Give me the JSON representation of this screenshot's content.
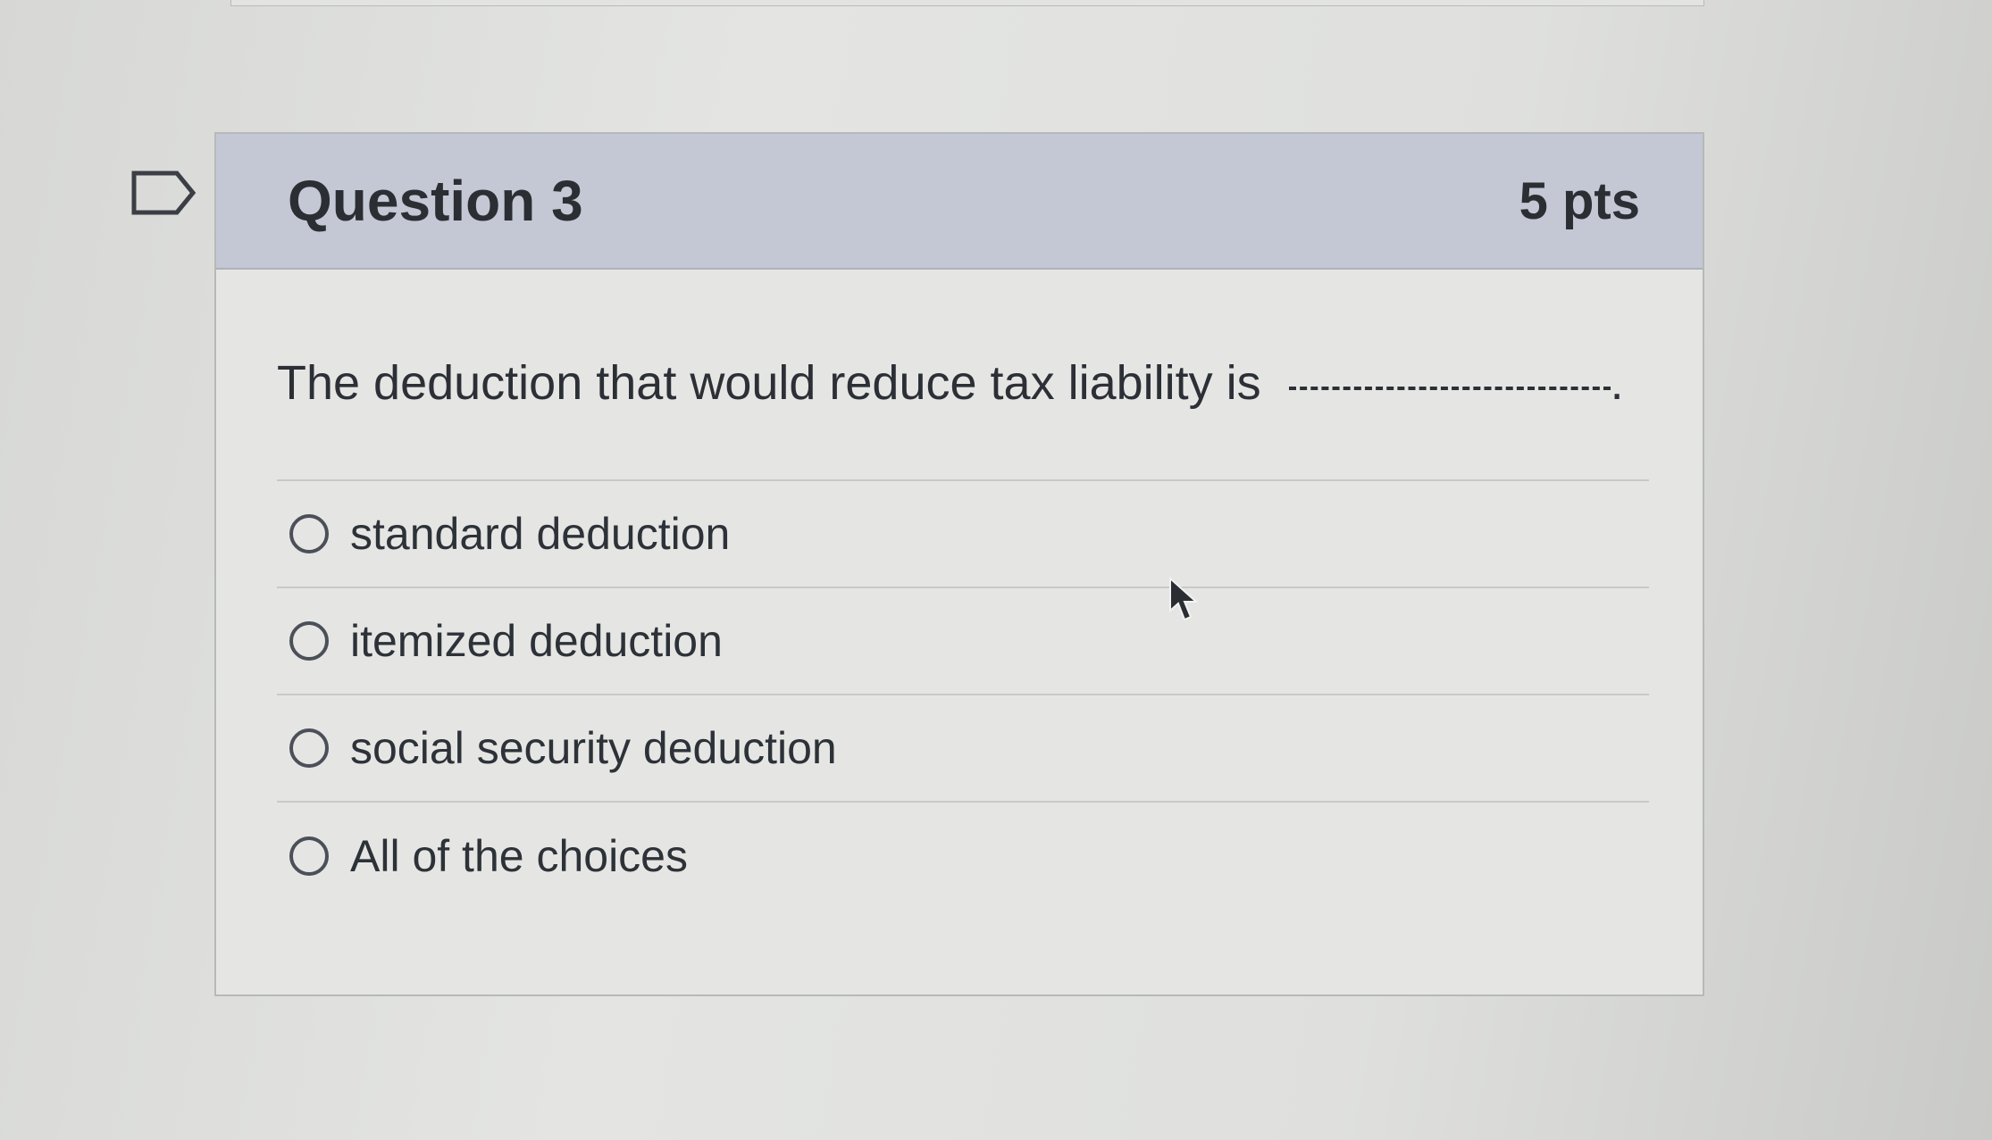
{
  "question": {
    "title": "Question 3",
    "points": "5 pts",
    "prompt": "The deduction that would reduce tax liability is",
    "prompt_end": ".",
    "answers": [
      {
        "label": "standard deduction"
      },
      {
        "label": "itemized deduction"
      },
      {
        "label": "social security deduction"
      },
      {
        "label": "All of the choices"
      }
    ]
  }
}
